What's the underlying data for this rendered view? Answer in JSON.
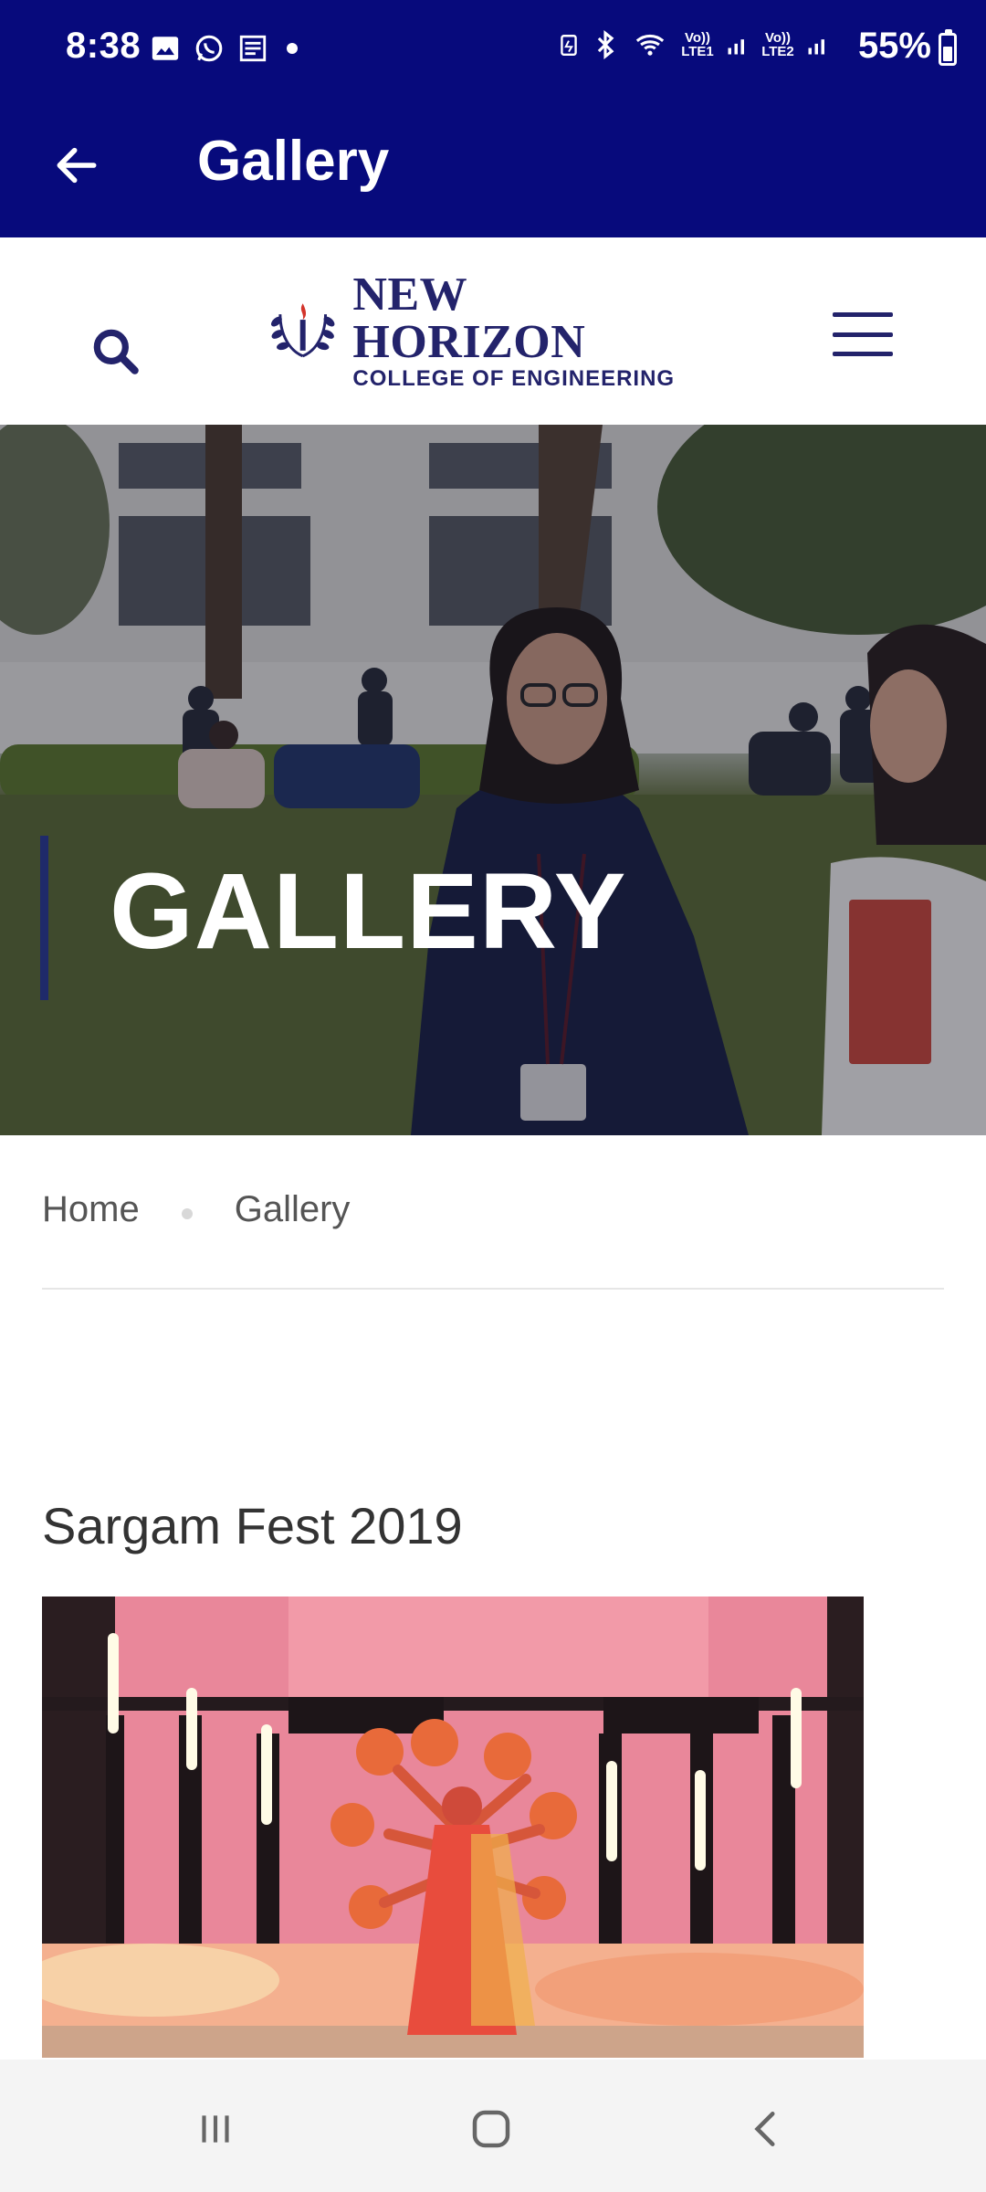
{
  "status_bar": {
    "time": "8:38",
    "battery": "55%",
    "sim1_label": "Vo)) LTE1",
    "sim2_label": "Vo)) LTE2",
    "icons_left": [
      "image-icon",
      "whatsapp-icon",
      "news-icon",
      "dot"
    ],
    "icons_right": [
      "battery-saver-icon",
      "bluetooth-icon",
      "wifi-icon",
      "signal-icon",
      "signal-icon"
    ]
  },
  "app_bar": {
    "title": "Gallery"
  },
  "site_header": {
    "logo_line1": "NEW HORIZON",
    "logo_line2": "COLLEGE OF ENGINEERING"
  },
  "hero": {
    "title": "GALLERY"
  },
  "breadcrumb": {
    "items": [
      "Home",
      "Gallery"
    ]
  },
  "content": {
    "section_title": "Sargam Fest 2019"
  },
  "colors": {
    "app_bar": "#070a7c",
    "logo": "#23236b",
    "nav_bar": "#f4f4f4"
  }
}
